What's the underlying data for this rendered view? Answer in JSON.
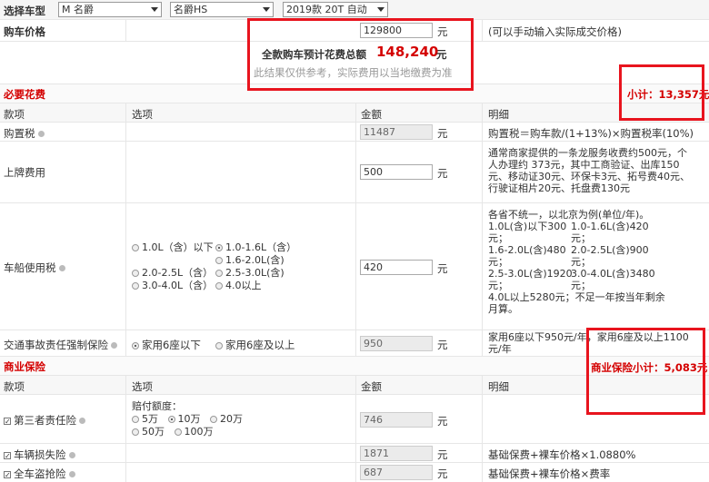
{
  "selector": {
    "label": "选择车型",
    "brand": "M 名爵",
    "model": "名爵HS",
    "version": "2019款 20T 自动"
  },
  "price_row": {
    "label": "购车价格",
    "value": "129800",
    "unit": "元",
    "hint": "(可以手动输入实际成交价格)"
  },
  "summary": {
    "label": "全款购车预计花费总额",
    "total": "148,240",
    "unit": "元",
    "note": "此结果仅供参考，实际费用以当地缴费为准"
  },
  "required": {
    "title": "必要花费",
    "subtotal": "小计：13,357元",
    "headers": {
      "item": "款项",
      "option": "选项",
      "amount": "金额",
      "detail": "明细"
    },
    "purchase_tax": {
      "label": "购置税",
      "value": "11487",
      "unit": "元",
      "detail": "购置税＝购车款/(1+13%)×购置税率(10%)"
    },
    "registration": {
      "label": "上牌费用",
      "value": "500",
      "unit": "元",
      "detail": [
        "通常商家提供的一条龙服务收费约500元，个",
        "人办理约 373元，其中工商验证、出库150",
        "元、移动证30元、环保卡3元、拓号费40元、",
        "行驶证相片20元、托盘费130元"
      ]
    },
    "vehicle_tax": {
      "label": "车船使用税",
      "value": "420",
      "unit": "元",
      "options": [
        "1.0L（含）以下",
        "1.0-1.6L（含）",
        "1.6-2.0L(含)",
        "2.0-2.5L（含）",
        "2.5-3.0L(含)",
        "3.0-4.0L（含）",
        "4.0以上"
      ],
      "detail": [
        "各省不统一，以北京为例(单位/年)。",
        "1.0L(含)以下300",
        "元；",
        "1.6-2.0L(含)480",
        "元；",
        "2.5-3.0L(含)1920",
        "元；",
        "4.0L以上5280元；不足一年按当年剩余",
        "月算。"
      ],
      "detail_right": [
        "1.0-1.6L(含)420",
        "元；",
        "2.0-2.5L(含)900",
        "元；",
        "3.0-4.0L(含)3480",
        "元；"
      ]
    },
    "compulsory": {
      "label": "交通事故责任强制保险",
      "value": "950",
      "unit": "元",
      "options": [
        "家用6座以下",
        "家用6座及以上"
      ],
      "detail": [
        "家用6座以下950元/年，家用6座及以上1100",
        "元/年"
      ]
    }
  },
  "commercial": {
    "title": "商业保险",
    "subtotal": "商业保险小计：5,083元",
    "headers": {
      "item": "款项",
      "option": "选项",
      "amount": "金额",
      "detail": "明细"
    },
    "third_party": {
      "label": "第三者责任险",
      "value": "746",
      "unit": "元",
      "options_label": "赔付额度：",
      "options": [
        "5万",
        "10万",
        "20万",
        "50万",
        "100万"
      ]
    },
    "damage": {
      "label": "车辆损失险",
      "value": "1871",
      "unit": "元",
      "detail": "基础保费+裸车价格×1.0880%"
    },
    "theft": {
      "label": "全车盗抢险",
      "value": "687",
      "unit": "元",
      "detail": "基础保费+裸车价格×费率"
    }
  }
}
